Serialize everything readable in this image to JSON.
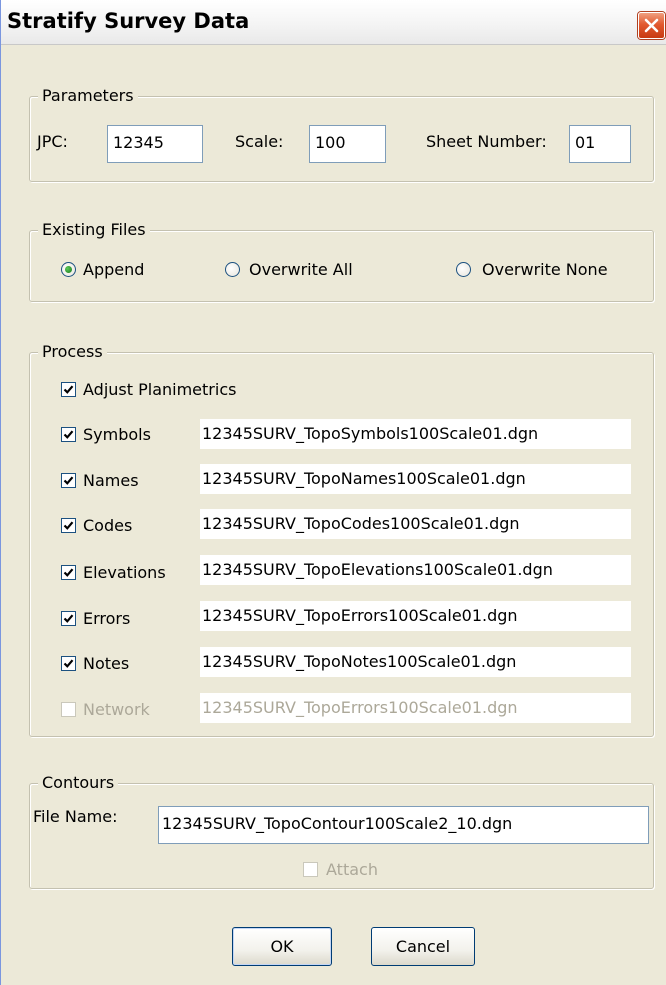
{
  "window": {
    "title": "Stratify Survey Data"
  },
  "parameters": {
    "legend": "Parameters",
    "jpc_label": "JPC:",
    "jpc_value": "12345",
    "scale_label": "Scale:",
    "scale_value": "100",
    "sheet_label": "Sheet Number:",
    "sheet_value": "01"
  },
  "existing_files": {
    "legend": "Existing Files",
    "options": [
      {
        "label": "Append",
        "selected": true
      },
      {
        "label": "Overwrite All",
        "selected": false
      },
      {
        "label": "Overwrite None",
        "selected": false
      }
    ]
  },
  "process": {
    "legend": "Process",
    "adjust_label": "Adjust Planimetrics",
    "adjust_checked": true,
    "items": [
      {
        "label": "Symbols",
        "checked": true,
        "enabled": true,
        "file": "12345SURV_TopoSymbols100Scale01.dgn"
      },
      {
        "label": "Names",
        "checked": true,
        "enabled": true,
        "file": "12345SURV_TopoNames100Scale01.dgn"
      },
      {
        "label": "Codes",
        "checked": true,
        "enabled": true,
        "file": "12345SURV_TopoCodes100Scale01.dgn"
      },
      {
        "label": "Elevations",
        "checked": true,
        "enabled": true,
        "file": "12345SURV_TopoElevations100Scale01.dgn"
      },
      {
        "label": "Errors",
        "checked": true,
        "enabled": true,
        "file": "12345SURV_TopoErrors100Scale01.dgn"
      },
      {
        "label": "Notes",
        "checked": true,
        "enabled": true,
        "file": "12345SURV_TopoNotes100Scale01.dgn"
      },
      {
        "label": "Network",
        "checked": false,
        "enabled": false,
        "file": "12345SURV_TopoErrors100Scale01.dgn"
      }
    ]
  },
  "contours": {
    "legend": "Contours",
    "file_label": "File Name:",
    "file_value": "12345SURV_TopoContour100Scale2_10.dgn",
    "attach_label": "Attach",
    "attach_checked": false,
    "attach_enabled": false
  },
  "buttons": {
    "ok": "OK",
    "cancel": "Cancel"
  }
}
